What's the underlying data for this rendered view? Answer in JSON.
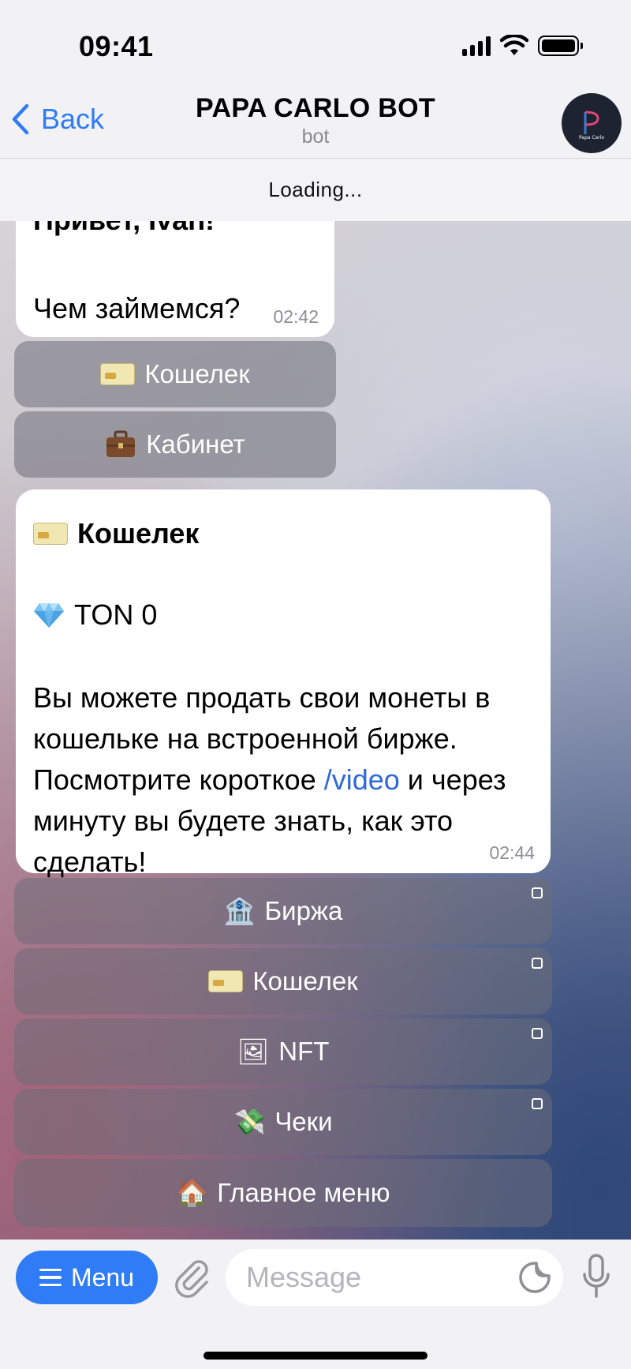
{
  "status_bar": {
    "time": "09:41"
  },
  "header": {
    "back_label": "Back",
    "title": "PAPA CARLO BOT",
    "subtitle": "bot",
    "avatar_text": "Papa Carlo"
  },
  "loading": {
    "text": "Loading..."
  },
  "messages": [
    {
      "greeting": "Привет, Ivan!",
      "question": "Чем займемся?",
      "time": "02:42",
      "buttons": [
        {
          "icon": "credit-card-icon",
          "label": "Кошелек"
        },
        {
          "icon": "briefcase-icon",
          "label": "Кабинет"
        }
      ]
    },
    {
      "heading": "Кошелек",
      "ton": "TON 0",
      "body_before": "Вы можете продать свои монеты в кошельке на встроенной бирже. Посмотрите короткое ",
      "link": "/video",
      "body_after": " и через минуту вы будете знать, как это сделать!",
      "time": "02:44",
      "buttons": [
        {
          "icon": "bank-icon",
          "emoji": "🏦",
          "label": "Биржа",
          "external": true
        },
        {
          "icon": "credit-card-icon",
          "label": "Кошелек",
          "external": true
        },
        {
          "icon": "picture-icon",
          "emoji": "🖼",
          "label": "NFT",
          "external": true
        },
        {
          "icon": "money-wings-icon",
          "emoji": "💸",
          "label": "Чеки",
          "external": true
        },
        {
          "icon": "house-icon",
          "emoji": "🏠",
          "label": "Главное меню",
          "external": false
        }
      ]
    }
  ],
  "input_bar": {
    "menu_label": "Menu",
    "placeholder": "Message"
  },
  "colors": {
    "accent": "#2f7cf6",
    "link": "#2f69d9"
  }
}
